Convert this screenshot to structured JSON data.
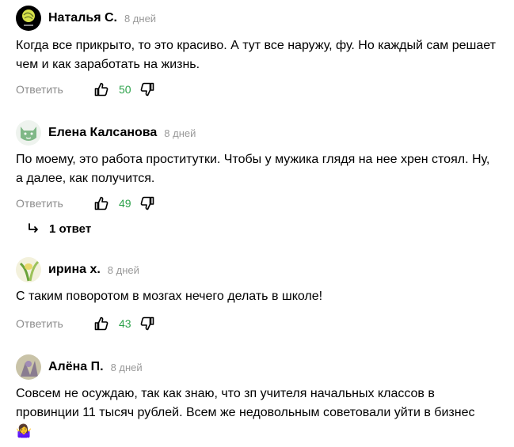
{
  "comments": [
    {
      "author": "Наталья С.",
      "date": "8 дней",
      "text": "Когда все прикрыто, то это красиво. А тут все наружу, фу. Но каждый сам решает чем и как заработать на жизнь.",
      "reply_label": "Ответить",
      "likes": "50"
    },
    {
      "author": "Елена Калсанова",
      "date": "8 дней",
      "text": "По моему, это работа проститутки. Чтобы у мужика глядя на нее хрен стоял. Ну, а далее, как получится.",
      "reply_label": "Ответить",
      "likes": "49",
      "replies_label": "1 ответ"
    },
    {
      "author": "ирина х.",
      "date": "8 дней",
      "text": "С таким поворотом в мозгах нечего делать в школе!",
      "reply_label": "Ответить",
      "likes": "43"
    },
    {
      "author": "Алёна П.",
      "date": "8 дней",
      "text": "Совсем не осуждаю, так как знаю, что зп учителя начальных классов в провинции 11 тысяч рублей. Всем же недовольным советовали уйти в бизнес",
      "emoji": "🤷‍♀️"
    }
  ],
  "colors": {
    "likes": "#2ca24a",
    "muted": "#999999"
  },
  "icons": [
    "like-icon",
    "dislike-icon",
    "reply-arrow-icon"
  ]
}
